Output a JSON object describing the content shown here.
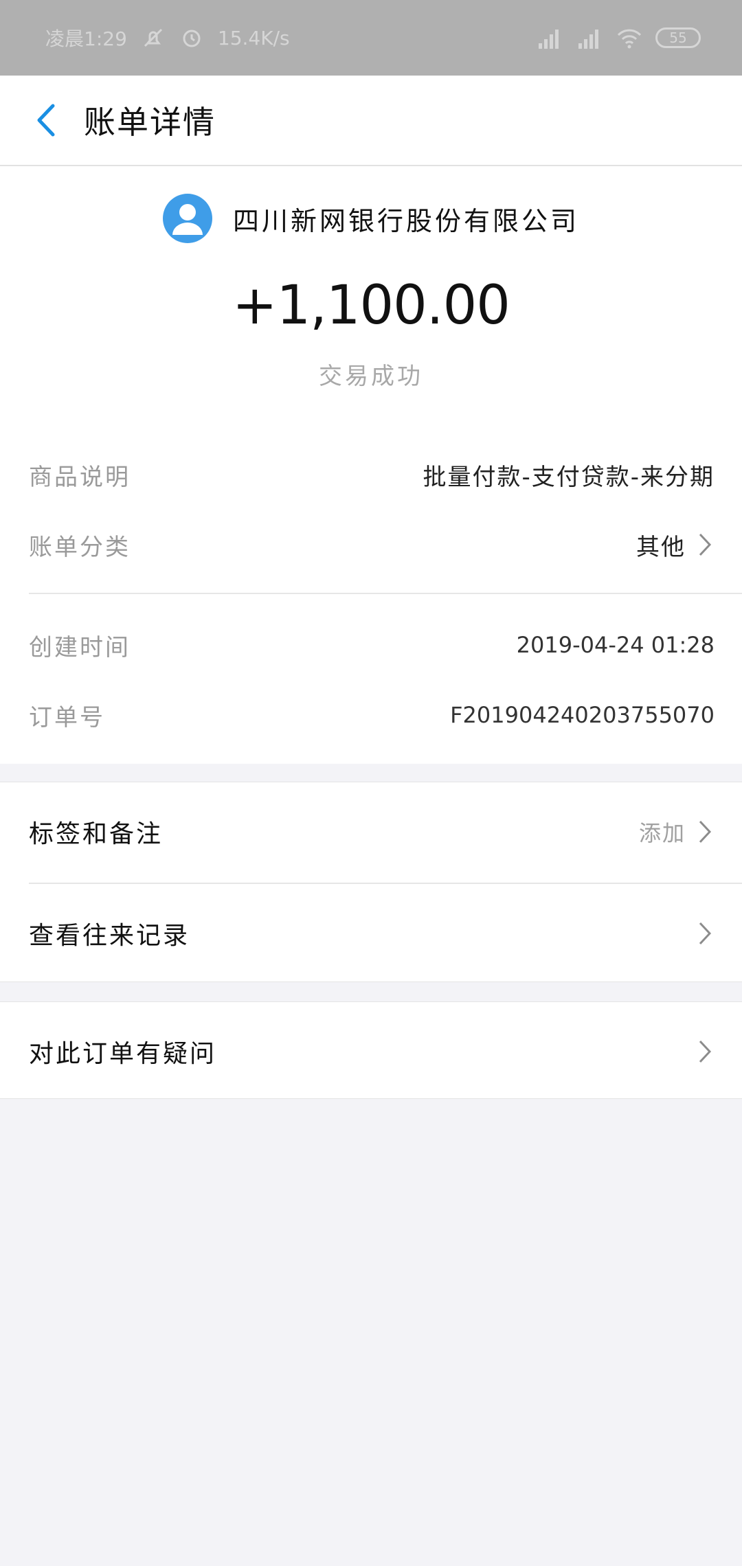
{
  "status_bar": {
    "time": "凌晨1:29",
    "net_speed": "15.4K/s",
    "battery": "55"
  },
  "header": {
    "title": "账单详情"
  },
  "summary": {
    "payee": "四川新网银行股份有限公司",
    "amount": "+1,100.00",
    "status": "交易成功"
  },
  "details": [
    {
      "label": "商品说明",
      "value": "批量付款-支付贷款-来分期"
    },
    {
      "label": "账单分类",
      "value": "其他"
    },
    {
      "label": "创建时间",
      "value": "2019-04-24 01:28"
    },
    {
      "label": "订单号",
      "value": "F201904240203755070"
    }
  ],
  "actions": {
    "tags_notes": {
      "label": "标签和备注",
      "hint": "添加"
    },
    "history": {
      "label": "查看往来记录"
    },
    "dispute": {
      "label": "对此订单有疑问"
    }
  },
  "colors": {
    "accent": "#1a8fe3",
    "avatar_bg": "#3f9de8",
    "status_bar_bg": "#b0b0b0",
    "page_bg": "#f3f3f7"
  }
}
